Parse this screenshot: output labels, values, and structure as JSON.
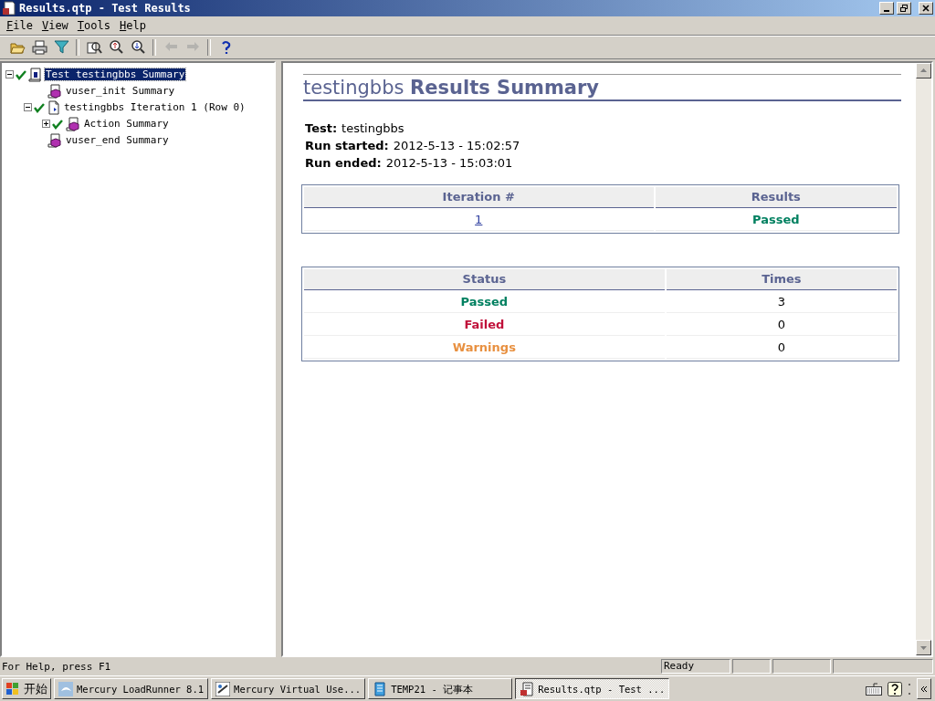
{
  "window": {
    "title": "Results.qtp - Test Results"
  },
  "menu": [
    {
      "label": "File"
    },
    {
      "label": "View"
    },
    {
      "label": "Tools"
    },
    {
      "label": "Help"
    }
  ],
  "toolbar": [
    {
      "kind": "open",
      "disabled": false
    },
    {
      "kind": "print",
      "disabled": false
    },
    {
      "kind": "filter",
      "disabled": false
    },
    {
      "kind": "sep"
    },
    {
      "kind": "find",
      "disabled": false
    },
    {
      "kind": "prev-error",
      "disabled": false
    },
    {
      "kind": "next-error",
      "disabled": false
    },
    {
      "kind": "sep"
    },
    {
      "kind": "back",
      "disabled": true
    },
    {
      "kind": "forward",
      "disabled": true
    },
    {
      "kind": "sep"
    },
    {
      "kind": "help",
      "disabled": false
    }
  ],
  "tree": [
    {
      "label": "Test testingbbs Summary",
      "kind": "test",
      "passed": true,
      "selected": true,
      "expanded": true,
      "children": [
        {
          "label": "vuser_init Summary",
          "kind": "script",
          "passed": false,
          "selected": false
        },
        {
          "label": "testingbbs Iteration 1 (Row 0)",
          "kind": "iteration",
          "passed": true,
          "selected": false,
          "expanded": true,
          "children": [
            {
              "label": "Action Summary",
              "kind": "script",
              "passed": true,
              "selected": false,
              "expanded": false
            }
          ]
        },
        {
          "label": "vuser_end Summary",
          "kind": "script",
          "passed": false,
          "selected": false
        }
      ]
    }
  ],
  "report": {
    "heading": "testingbbs **Results Summary**",
    "info": [
      {
        "label": "Test:",
        "value": "testingbbs"
      },
      {
        "label": "Run started:",
        "value": "2012-5-13 - 15:02:57"
      },
      {
        "label": "Run ended:",
        "value": "2012-5-13 - 15:03:01"
      }
    ],
    "iterations": {
      "columns": [
        "Iteration #",
        "Results"
      ],
      "rows": [
        {
          "iteration": "1",
          "result": "Passed",
          "color": "#008060"
        }
      ]
    },
    "statuses": {
      "columns": [
        "Status",
        "Times"
      ],
      "rows": [
        {
          "status": "Passed",
          "color": "#008060",
          "times": "3"
        },
        {
          "status": "Failed",
          "color": "#c0103a",
          "times": "0"
        },
        {
          "status": "Warnings",
          "color": "#e89040",
          "times": "0"
        }
      ]
    }
  },
  "status_bar": {
    "help": "For Help, press F1",
    "state": "Ready"
  },
  "taskbar": {
    "start": "开始",
    "tasks": [
      {
        "label": "Mercury LoadRunner 8.1",
        "kind": "loadrunner",
        "selected": false
      },
      {
        "label": "Mercury Virtual Use...",
        "kind": "vugen",
        "selected": false
      },
      {
        "label": "TEMP21 - 记事本",
        "kind": "notepad",
        "selected": false
      },
      {
        "label": "Results.qtp - Test ...",
        "kind": "results",
        "selected": true
      }
    ]
  }
}
